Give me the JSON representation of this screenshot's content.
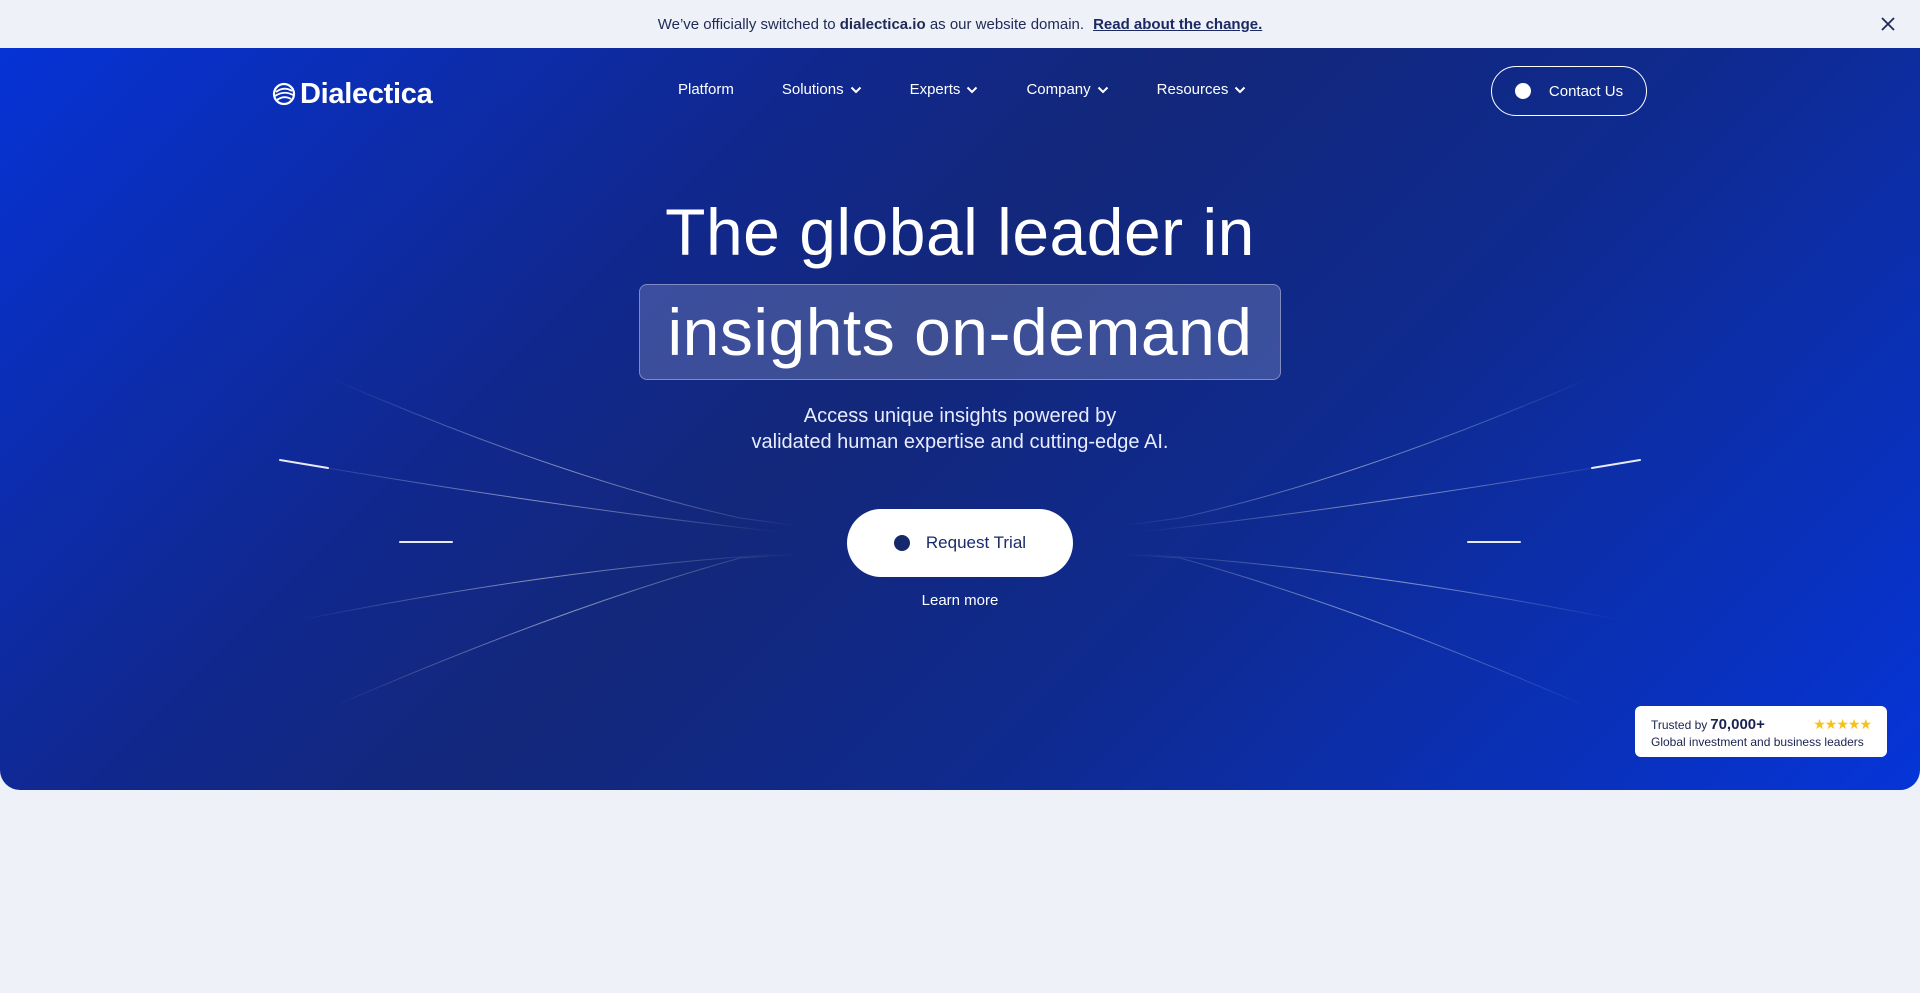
{
  "banner": {
    "prefix": "We’ve officially switched to",
    "domain": "dialectica.io",
    "suffix": "as our website domain.",
    "link": "Read about the change."
  },
  "header": {
    "logo": "Dialectica",
    "nav": [
      {
        "label": "Platform",
        "dropdown": false
      },
      {
        "label": "Solutions",
        "dropdown": true
      },
      {
        "label": "Experts",
        "dropdown": true
      },
      {
        "label": "Company",
        "dropdown": true
      },
      {
        "label": "Resources",
        "dropdown": true
      }
    ],
    "contact_label": "Contact Us"
  },
  "hero": {
    "headline_line1": "The global leader in",
    "headline_highlight": "insights on-demand",
    "subhead_line1": "Access unique insights powered by",
    "subhead_line2": "validated human expertise and cutting-edge AI.",
    "cta_label": "Request Trial",
    "learn_more": "Learn more"
  },
  "trust_badge": {
    "prefix": "Trusted by",
    "count": "70,000+",
    "stars": "★★★★★",
    "rating": 5,
    "caption": "Global investment and business leaders"
  },
  "colors": {
    "hero_blue": "#0633d6",
    "hero_navy": "#13287a",
    "banner_bg": "#eef1f8",
    "star": "#f4c21b"
  }
}
